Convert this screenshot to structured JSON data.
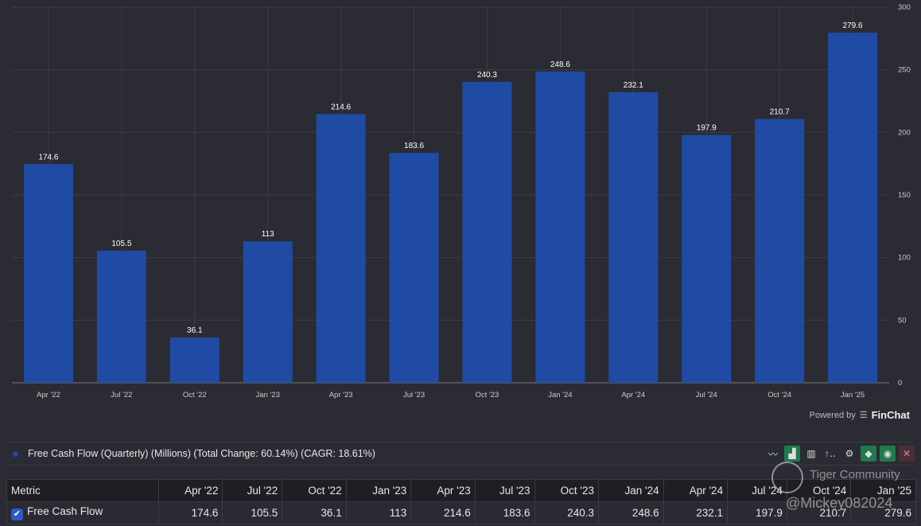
{
  "chart_data": {
    "type": "bar",
    "categories": [
      "Apr '22",
      "Jul '22",
      "Oct '22",
      "Jan '23",
      "Apr '23",
      "Jul '23",
      "Oct '23",
      "Jan '24",
      "Apr '24",
      "Jul '24",
      "Oct '24",
      "Jan '25"
    ],
    "series": [
      {
        "name": "Free Cash Flow (Quarterly) (Millions)",
        "values": [
          174.6,
          105.5,
          36.1,
          113,
          214.6,
          183.6,
          240.3,
          248.6,
          232.1,
          197.9,
          210.7,
          279.6
        ]
      }
    ],
    "data_labels": [
      "174.6",
      "105.5",
      "36.1",
      "113",
      "214.6",
      "183.6",
      "240.3",
      "248.6",
      "232.1",
      "197.9",
      "210.7",
      "279.6"
    ],
    "ylim": [
      0,
      300
    ],
    "yticks": [
      0,
      50,
      100,
      150,
      200,
      250,
      300
    ],
    "y_axis_side": "right",
    "grid": true,
    "bar_color": "#1f4ba5",
    "background": "#2b2b33"
  },
  "branding": {
    "powered_by": "Powered by",
    "brand": "FinChat"
  },
  "legend": {
    "text": "Free Cash Flow (Quarterly) (Millions) (Total Change: 60.14%) (CAGR: 18.61%)"
  },
  "toolbar": {
    "icons": [
      "line-chart-icon",
      "bar-chart-icon",
      "stacked-bar-icon",
      "sort-icon",
      "gear-icon",
      "tag-icon",
      "eye-icon",
      "close-icon"
    ]
  },
  "table": {
    "metric_header": "Metric",
    "columns": [
      "Apr '22",
      "Jul '22",
      "Oct '22",
      "Jan '23",
      "Apr '23",
      "Jul '23",
      "Oct '23",
      "Jan '24",
      "Apr '24",
      "Jul '24",
      "Oct '24",
      "Jan '25"
    ],
    "rows": [
      {
        "label": "Free Cash Flow",
        "checked": true,
        "values": [
          "174.6",
          "105.5",
          "36.1",
          "113",
          "214.6",
          "183.6",
          "240.3",
          "248.6",
          "232.1",
          "197.9",
          "210.7",
          "279.6"
        ]
      }
    ]
  },
  "watermark": {
    "line1": "Tiger Community",
    "line2": "@Mickey082024"
  }
}
